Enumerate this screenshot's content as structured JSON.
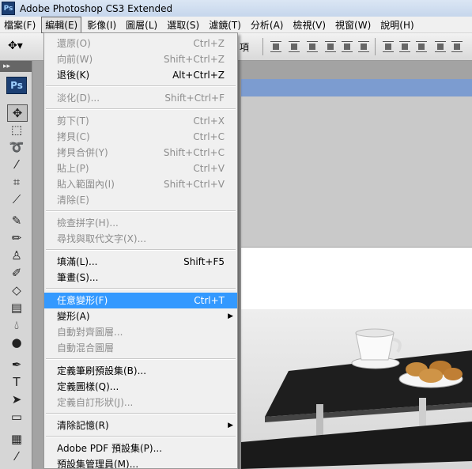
{
  "window": {
    "title": "Adobe Photoshop CS3 Extended",
    "app_badge": "Ps"
  },
  "menubar": [
    {
      "label": "檔案(F)"
    },
    {
      "label": "編輯(E)",
      "active": true
    },
    {
      "label": "影像(I)"
    },
    {
      "label": "圖層(L)"
    },
    {
      "label": "選取(S)"
    },
    {
      "label": "濾鏡(T)"
    },
    {
      "label": "分析(A)"
    },
    {
      "label": "檢視(V)"
    },
    {
      "label": "視窗(W)"
    },
    {
      "label": "說明(H)"
    }
  ],
  "optionsbar": {
    "partial_label": "項",
    "tool_icon": "move-tool-icon"
  },
  "toolbox": {
    "header": "▸▸",
    "badge": "Ps"
  },
  "edit_menu": {
    "groups": [
      [
        {
          "label": "還原(O)",
          "shortcut": "Ctrl+Z",
          "disabled": true
        },
        {
          "label": "向前(W)",
          "shortcut": "Shift+Ctrl+Z",
          "disabled": true
        },
        {
          "label": "退後(K)",
          "shortcut": "Alt+Ctrl+Z",
          "disabled": false
        }
      ],
      [
        {
          "label": "淡化(D)...",
          "shortcut": "Shift+Ctrl+F",
          "disabled": true
        }
      ],
      [
        {
          "label": "剪下(T)",
          "shortcut": "Ctrl+X",
          "disabled": true
        },
        {
          "label": "拷貝(C)",
          "shortcut": "Ctrl+C",
          "disabled": true
        },
        {
          "label": "拷貝合併(Y)",
          "shortcut": "Shift+Ctrl+C",
          "disabled": true
        },
        {
          "label": "貼上(P)",
          "shortcut": "Ctrl+V",
          "disabled": true
        },
        {
          "label": "貼入範圍內(I)",
          "shortcut": "Shift+Ctrl+V",
          "disabled": true
        },
        {
          "label": "清除(E)",
          "shortcut": "",
          "disabled": true
        }
      ],
      [
        {
          "label": "檢查拼字(H)...",
          "shortcut": "",
          "disabled": true
        },
        {
          "label": "尋找與取代文字(X)...",
          "shortcut": "",
          "disabled": true
        }
      ],
      [
        {
          "label": "填滿(L)...",
          "shortcut": "Shift+F5",
          "disabled": false
        },
        {
          "label": "筆畫(S)...",
          "shortcut": "",
          "disabled": false
        }
      ],
      [
        {
          "label": "任意變形(F)",
          "shortcut": "Ctrl+T",
          "disabled": false,
          "highlighted": true
        },
        {
          "label": "變形(A)",
          "shortcut": "",
          "disabled": false,
          "submenu": true
        },
        {
          "label": "自動對齊圖層...",
          "shortcut": "",
          "disabled": true
        },
        {
          "label": "自動混合圖層",
          "shortcut": "",
          "disabled": true
        }
      ],
      [
        {
          "label": "定義筆刷預設集(B)...",
          "shortcut": "",
          "disabled": false
        },
        {
          "label": "定義圖樣(Q)...",
          "shortcut": "",
          "disabled": false
        },
        {
          "label": "定義自訂形狀(J)...",
          "shortcut": "",
          "disabled": true
        }
      ],
      [
        {
          "label": "清除記憶(R)",
          "shortcut": "",
          "disabled": false,
          "submenu": true
        }
      ],
      [
        {
          "label": "Adobe PDF 預設集(P)...",
          "shortcut": "",
          "disabled": false
        },
        {
          "label": "預設集管理員(M)...",
          "shortcut": "",
          "disabled": false
        }
      ]
    ]
  },
  "colors": {
    "menu_highlight": "#3399ff",
    "doc_tab": "#7c9cd0",
    "photoshop_blue": "#1c3f73"
  }
}
